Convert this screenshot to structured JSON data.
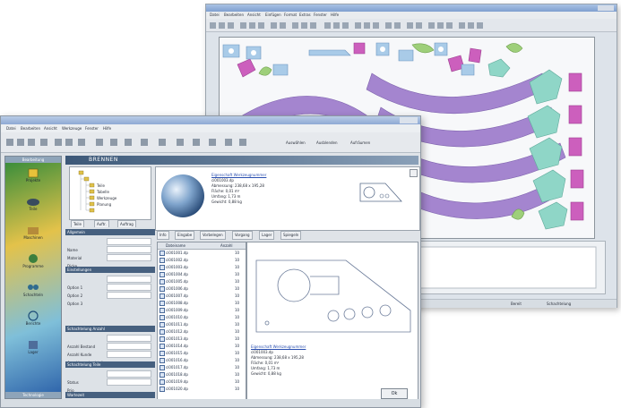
{
  "back_window": {
    "menu_items": [
      "Datei",
      "Bearbeiten",
      "Ansicht",
      "Einfügen",
      "Format",
      "Extras",
      "Fenster",
      "Hilfe"
    ],
    "status_left": "Bereit",
    "status_right": "Schachtelung"
  },
  "front_window": {
    "menu_items": [
      "Datei",
      "Bearbeiten",
      "Ansicht",
      "Werkzeuge",
      "Fenster",
      "Hilfe"
    ],
    "toolbar_right": [
      "Auswählen",
      "Ausblenden",
      "Aufräumen"
    ],
    "sidebar": {
      "header": "Bearbeitung",
      "items": [
        {
          "label": "Projekte",
          "icon": "projects-icon"
        },
        {
          "label": "Teile",
          "icon": "parts-icon"
        },
        {
          "label": "Maschinen",
          "icon": "machine-icon"
        },
        {
          "label": "Programme",
          "icon": "program-icon"
        },
        {
          "label": "Schachteln",
          "icon": "nesting-icon"
        },
        {
          "label": "Berichte",
          "icon": "report-icon"
        },
        {
          "label": "Lager",
          "icon": "storage-icon"
        }
      ],
      "footer": "Technologie"
    },
    "banner": "BRENNEN",
    "tree_tabs": [
      "Teile",
      "Auftr.",
      "Auftrag"
    ],
    "mid_sections": [
      {
        "title": "Allgemein",
        "props": [
          "Name",
          "Material",
          "Dicke"
        ]
      },
      {
        "title": "Einstellungen",
        "props": [
          "Option 1",
          "Option 2",
          "Option 3"
        ]
      },
      {
        "title": "Schachtelung Anzahl",
        "props": [
          "Anzahl Bestand",
          "Anzahl Kunde",
          "Anzahl geschachtelt"
        ]
      },
      {
        "title": "Schachtelung Teile",
        "props": [
          "Status",
          "Prio"
        ]
      },
      {
        "title": "Wartezeit",
        "props": []
      }
    ],
    "part_info": {
      "link": "Eigenschaft Werkzeugnummer",
      "name": "ci001003.dp",
      "lines": [
        "Abmessung: 238,68 x 195,28",
        "Fläche: 0,01 m²",
        "Umfang: 1,73 m",
        "Gewicht: 0,88 kg"
      ]
    },
    "tabs": [
      "Info",
      "Eingabe",
      "Vorbelegen",
      "Vorgang",
      "Lager",
      "Spiegeln"
    ],
    "list_headers": [
      "Dateiname",
      "Anzahl"
    ],
    "files": [
      {
        "name": "ci001001.dp",
        "qty": "10"
      },
      {
        "name": "ci001002.dp",
        "qty": "10"
      },
      {
        "name": "ci001003.dp",
        "qty": "10"
      },
      {
        "name": "ci001004.dp",
        "qty": "10"
      },
      {
        "name": "ci001005.dp",
        "qty": "10"
      },
      {
        "name": "ci001006.dp",
        "qty": "10"
      },
      {
        "name": "ci001007.dp",
        "qty": "10"
      },
      {
        "name": "ci001008.dp",
        "qty": "10"
      },
      {
        "name": "ci001009.dp",
        "qty": "10"
      },
      {
        "name": "ci001010.dp",
        "qty": "10"
      },
      {
        "name": "ci001011.dp",
        "qty": "10"
      },
      {
        "name": "ci001012.dp",
        "qty": "10"
      },
      {
        "name": "ci001013.dp",
        "qty": "10"
      },
      {
        "name": "ci001014.dp",
        "qty": "10"
      },
      {
        "name": "ci001015.dp",
        "qty": "10"
      },
      {
        "name": "ci001016.dp",
        "qty": "10"
      },
      {
        "name": "ci001017.dp",
        "qty": "10"
      },
      {
        "name": "ci001018.dp",
        "qty": "10"
      },
      {
        "name": "ci001019.dp",
        "qty": "10"
      },
      {
        "name": "ci001020.dp",
        "qty": "10"
      }
    ],
    "preview_info": {
      "link": "Eigenschaft Werkzeugnummer",
      "name": "ci001003.dp",
      "lines": [
        "Abmessung: 238,68 x 195,28",
        "Fläche: 0,01 m²",
        "Umfang: 1,73 m",
        "Gewicht: 0,88 kg"
      ]
    },
    "ok_label": "Ok"
  },
  "colors": {
    "purple": "#a485cf",
    "purple_dark": "#8f6fc0",
    "teal": "#8fd6c7",
    "blue": "#a9cbe8",
    "green": "#9ecf7a",
    "pink": "#cc5fbd"
  }
}
